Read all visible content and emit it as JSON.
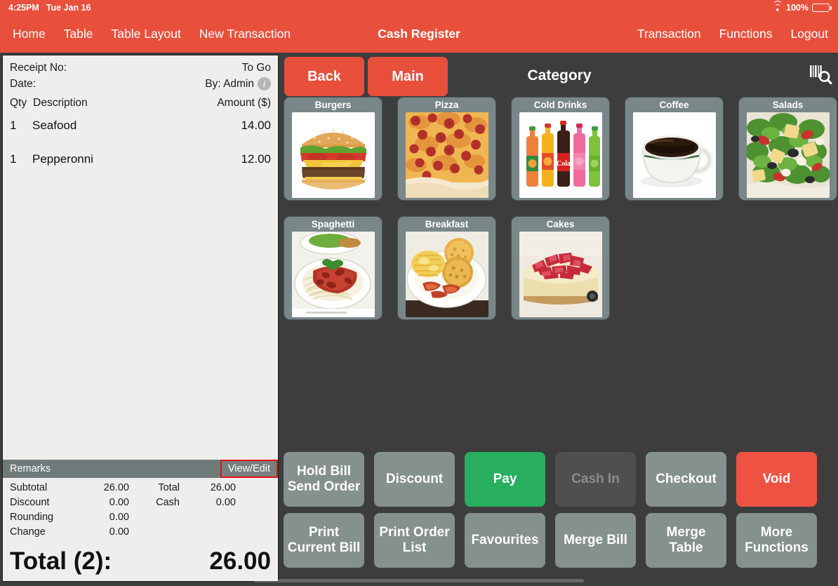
{
  "colors": {
    "brand_red": "#e8503c",
    "panel_dark": "#3d3d3d",
    "tile_grey": "#798789",
    "action_grey": "#85918f",
    "pay_green": "#27ae5e",
    "void_red": "#ee5242",
    "highlight_red": "#e81010"
  },
  "statusbar": {
    "time": "4:25PM",
    "date": "Tue Jan 16",
    "wifi_icon": "wifi-icon",
    "battery_percent": "100%",
    "battery_icon": "battery-icon"
  },
  "navbar": {
    "title": "Cash Register",
    "left_items": [
      {
        "label": "Home"
      },
      {
        "label": "Table"
      },
      {
        "label": "Table Layout"
      },
      {
        "label": "New Transaction"
      }
    ],
    "right_items": [
      {
        "label": "Transaction"
      },
      {
        "label": "Functions"
      },
      {
        "label": "Logout"
      }
    ]
  },
  "receipt": {
    "receipt_no_label": "Receipt No:",
    "receipt_no_value": "",
    "order_type": "To Go",
    "date_label": "Date:",
    "date_value": "",
    "by_label": "By: Admin",
    "info_icon": "info-icon",
    "columns": {
      "qty": "Qty",
      "description": "Description",
      "amount": "Amount ($)"
    },
    "items": [
      {
        "qty": "1",
        "description": "Seafood",
        "amount": "14.00"
      },
      {
        "qty": "1",
        "description": "Pepperonni",
        "amount": "12.00"
      }
    ],
    "remarks_label": "Remarks",
    "view_edit_label": "View/Edit",
    "totals": [
      {
        "label": "Subtotal",
        "value": "26.00",
        "label2": "Total",
        "value2": "26.00"
      },
      {
        "label": "Discount",
        "value": "0.00",
        "label2": "Cash",
        "value2": "0.00"
      },
      {
        "label": "Rounding",
        "value": "0.00",
        "label2": "",
        "value2": ""
      },
      {
        "label": "Change",
        "value": "0.00",
        "label2": "",
        "value2": ""
      }
    ],
    "grand_total_label": "Total (2):",
    "grand_total_value": "26.00"
  },
  "content": {
    "back_label": "Back",
    "main_label": "Main",
    "category_title": "Category",
    "scan_icon": "barcode-scan-search-icon",
    "categories_row1": [
      {
        "label": "Burgers",
        "image": "burger-photo"
      },
      {
        "label": "Pizza",
        "image": "pizza-photo"
      },
      {
        "label": "Cold Drinks",
        "image": "soda-bottles-photo"
      },
      {
        "label": "Coffee",
        "image": "coffee-cup-photo"
      },
      {
        "label": "Salads",
        "image": "salad-photo"
      }
    ],
    "categories_row2": [
      {
        "label": "Spaghetti",
        "image": "spaghetti-photo"
      },
      {
        "label": "Breakfast",
        "image": "breakfast-photo"
      },
      {
        "label": "Cakes",
        "image": "strawberry-cheesecake-photo"
      }
    ]
  },
  "actions": {
    "row1": [
      {
        "label": "Hold Bill\nSend Order",
        "style": "grey",
        "name": "hold-bill-send-order-button"
      },
      {
        "label": "Discount",
        "style": "grey",
        "name": "discount-button"
      },
      {
        "label": "Pay",
        "style": "green",
        "name": "pay-button"
      },
      {
        "label": "Cash In",
        "style": "disabled",
        "name": "cash-in-button"
      },
      {
        "label": "Checkout",
        "style": "grey",
        "name": "checkout-button"
      },
      {
        "label": "Void",
        "style": "red",
        "name": "void-button"
      }
    ],
    "row2": [
      {
        "label": "Print\nCurrent Bill",
        "style": "grey",
        "name": "print-current-bill-button"
      },
      {
        "label": "Print Order\nList",
        "style": "grey",
        "name": "print-order-list-button"
      },
      {
        "label": "Favourites",
        "style": "grey",
        "name": "favourites-button"
      },
      {
        "label": "Merge Bill",
        "style": "grey",
        "name": "merge-bill-button"
      },
      {
        "label": "Merge Table",
        "style": "grey",
        "name": "merge-table-button"
      },
      {
        "label": "More\nFunctions",
        "style": "grey",
        "name": "more-functions-button"
      }
    ]
  }
}
